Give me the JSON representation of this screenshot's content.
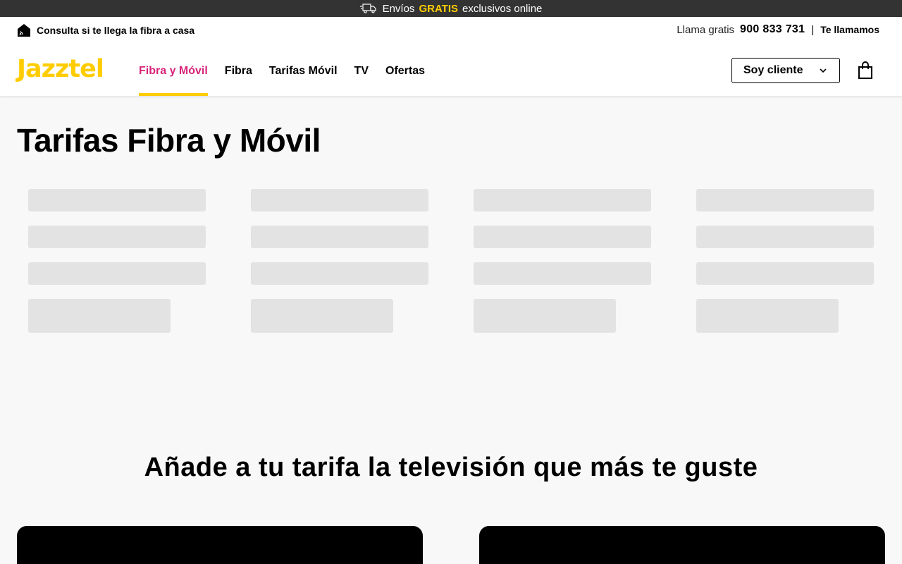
{
  "promo": {
    "prefix": "Envíos",
    "highlight": "GRATIS",
    "suffix": "exclusivos online",
    "icon": "truck-icon"
  },
  "topbar": {
    "fiber_check": "Consulta si te llega la fibra a casa",
    "call_label": "Llama gratis",
    "phone": "900 833 731",
    "separator": "|",
    "callback": "Te llamamos"
  },
  "header": {
    "logo": "Jazztel",
    "nav": [
      {
        "label": "Fibra y Móvil",
        "active": true
      },
      {
        "label": "Fibra",
        "active": false
      },
      {
        "label": "Tarifas Móvil",
        "active": false
      },
      {
        "label": "TV",
        "active": false
      },
      {
        "label": "Ofertas",
        "active": false
      }
    ],
    "client_button": "Soy cliente"
  },
  "main": {
    "title": "Tarifas Fibra y Móvil",
    "tv_section_title": "Añade a tu tarifa la televisión que más te guste"
  },
  "colors": {
    "brand_yellow": "#ffcc00",
    "active_nav": "#d6247a",
    "promo_bg": "#333333",
    "skeleton": "#e3e3e3"
  }
}
